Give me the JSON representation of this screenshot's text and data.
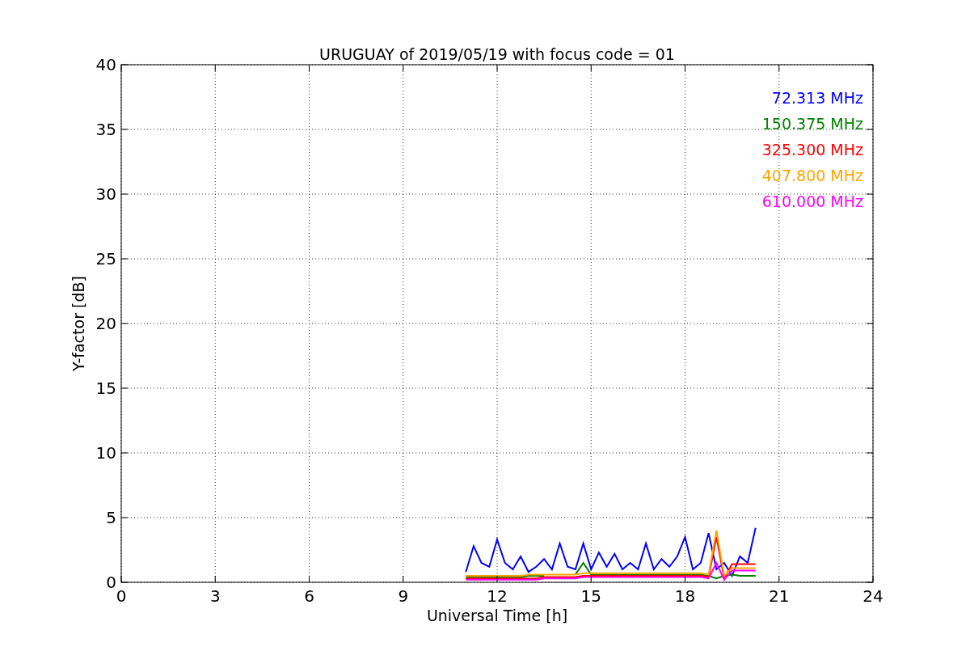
{
  "chart_data": {
    "type": "line",
    "title": "URUGUAY of 2019/05/19 with focus code = 01",
    "xlabel": "Universal Time [h]",
    "ylabel": "Y-factor [dB]",
    "x": [
      11,
      11.25,
      11.5,
      11.75,
      12,
      12.25,
      12.5,
      12.75,
      13,
      13.25,
      13.5,
      13.75,
      14,
      14.25,
      14.5,
      14.75,
      15,
      15.25,
      15.5,
      15.75,
      16,
      16.25,
      16.5,
      16.75,
      17,
      17.25,
      17.5,
      17.75,
      18,
      18.25,
      18.5,
      18.75,
      19,
      19.25,
      19.5,
      19.75,
      20,
      20.25
    ],
    "series": [
      {
        "name": "72.313 MHz",
        "color": "#0000ff",
        "values": [
          0.8,
          2.8,
          1.5,
          1.2,
          3.3,
          1.5,
          1.0,
          2.0,
          0.8,
          1.2,
          1.8,
          1.0,
          3.0,
          1.2,
          1.0,
          3.0,
          1.0,
          2.3,
          1.2,
          2.2,
          1.0,
          1.5,
          1.0,
          3.0,
          1.0,
          1.8,
          1.2,
          2.0,
          3.5,
          1.0,
          1.5,
          3.8,
          1.0,
          1.5,
          0.5,
          2.0,
          1.5,
          4.2
        ]
      },
      {
        "name": "150.375 MHz",
        "color": "#008000",
        "values": [
          0.4,
          0.4,
          0.4,
          0.4,
          0.4,
          0.4,
          0.4,
          0.4,
          0.5,
          0.5,
          0.5,
          null,
          null,
          null,
          0.6,
          1.5,
          0.6,
          0.6,
          0.6,
          0.6,
          0.6,
          0.6,
          0.6,
          0.6,
          0.6,
          0.6,
          0.6,
          0.6,
          0.6,
          0.6,
          0.6,
          0.5,
          0.3,
          0.5,
          0.6,
          0.5,
          0.5,
          0.5
        ]
      },
      {
        "name": "325.300 MHz",
        "color": "#ff0000",
        "values": [
          0.3,
          0.3,
          0.3,
          0.3,
          0.3,
          0.3,
          0.3,
          0.3,
          0.3,
          0.3,
          0.4,
          0.4,
          0.4,
          0.4,
          0.4,
          0.5,
          0.5,
          0.5,
          0.5,
          0.5,
          0.5,
          0.5,
          0.5,
          0.5,
          0.5,
          0.5,
          0.5,
          0.5,
          0.5,
          0.5,
          0.5,
          0.4,
          3.5,
          0.3,
          1.4,
          1.4,
          1.4,
          1.4
        ]
      },
      {
        "name": "407.800 MHz",
        "color": "#ffa500",
        "values": [
          0.5,
          0.5,
          0.5,
          0.5,
          0.5,
          0.5,
          0.5,
          0.5,
          0.6,
          0.6,
          0.6,
          0.6,
          0.6,
          0.6,
          0.6,
          0.7,
          0.7,
          0.7,
          0.7,
          0.7,
          0.7,
          0.7,
          0.7,
          0.7,
          0.7,
          0.7,
          0.7,
          0.7,
          0.7,
          0.7,
          0.7,
          0.6,
          4.0,
          0.5,
          1.1,
          1.1,
          1.1,
          1.1
        ]
      },
      {
        "name": "610.000 MHz",
        "color": "#ff00ff",
        "values": [
          0.2,
          0.2,
          0.2,
          0.2,
          0.2,
          0.2,
          0.2,
          0.2,
          0.2,
          0.2,
          0.3,
          0.3,
          0.3,
          0.3,
          0.3,
          0.4,
          0.4,
          0.4,
          0.4,
          0.4,
          0.4,
          0.4,
          0.4,
          0.4,
          0.4,
          0.4,
          0.4,
          0.4,
          0.4,
          0.4,
          0.4,
          0.3,
          1.5,
          0.2,
          0.9,
          0.9,
          0.9,
          0.9
        ]
      }
    ],
    "grid": true,
    "xlim": [
      0,
      24
    ],
    "ylim": [
      0,
      40
    ],
    "xticks": [
      0,
      3,
      6,
      9,
      12,
      15,
      18,
      21,
      24
    ],
    "yticks": [
      0,
      5,
      10,
      15,
      20,
      25,
      30,
      35,
      40
    ]
  }
}
